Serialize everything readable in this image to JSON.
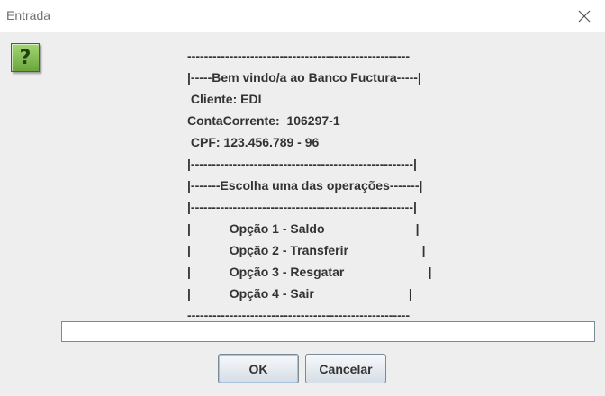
{
  "window": {
    "title": "Entrada",
    "close_icon": "close-icon"
  },
  "icon": {
    "name": "question-icon",
    "glyph": "?"
  },
  "message": {
    "lines": [
      "-----------------------------------------------------",
      "|-----Bem vindo/a ao Banco Fuctura-----|",
      " Cliente: EDI",
      "ContaCorrente:  106297-1",
      " CPF: 123.456.789 - 96",
      "|-----------------------------------------------------|",
      "|-------Escolha uma das operações-------|",
      "|-----------------------------------------------------|",
      "|           Opção 1 - Saldo                          |",
      "|           Opção 2 - Transferir                     |",
      "|           Opção 3 - Resgatar                        |",
      "|           Opção 4 - Sair                           |",
      "-----------------------------------------------------"
    ]
  },
  "input": {
    "value": ""
  },
  "buttons": {
    "ok": "OK",
    "cancel": "Cancelar"
  }
}
